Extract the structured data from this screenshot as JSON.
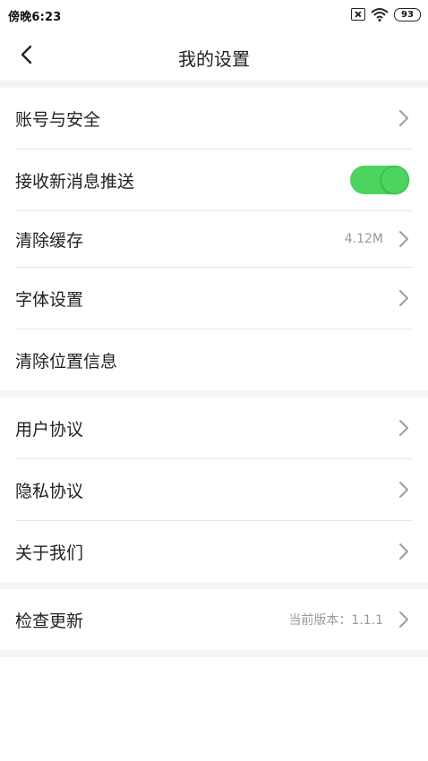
{
  "status_bar": {
    "time": "傍晚6:23",
    "battery": "93",
    "icons": [
      "no-sim-icon",
      "wifi-icon",
      "battery-icon"
    ]
  },
  "header": {
    "title": "我的设置",
    "back_icon": "chevron-left-icon"
  },
  "settings": {
    "account_security": {
      "label": "账号与安全"
    },
    "push_notifications": {
      "label": "接收新消息推送",
      "enabled": true
    },
    "clear_cache": {
      "label": "清除缓存",
      "value": "4.12M"
    },
    "font_settings": {
      "label": "字体设置"
    },
    "clear_location": {
      "label": "清除位置信息"
    },
    "user_agreement": {
      "label": "用户协议"
    },
    "privacy_agreement": {
      "label": "隐私协议"
    },
    "about_us": {
      "label": "关于我们"
    },
    "check_update": {
      "label": "检查更新",
      "value": "当前版本：1.1.1"
    }
  },
  "colors": {
    "accent_green": "#4cd460",
    "section_gap": "#f5f5f5",
    "secondary_text": "#9a9a9a"
  }
}
